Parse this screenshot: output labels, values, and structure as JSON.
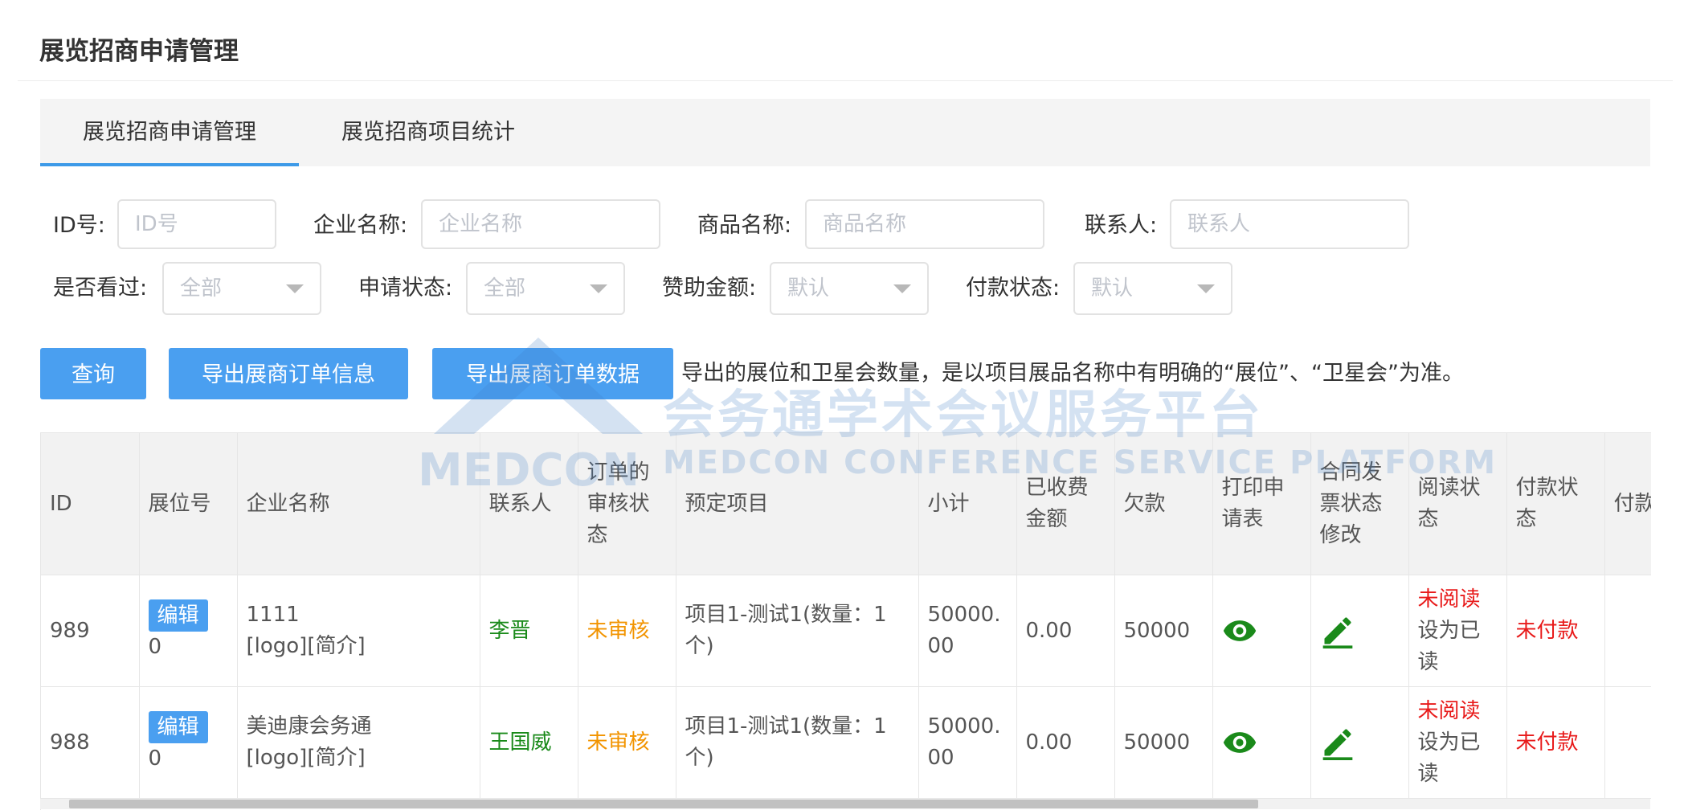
{
  "page_title": "展览招商申请管理",
  "tabs": [
    {
      "label": "展览招商申请管理",
      "active": true
    },
    {
      "label": "展览招商项目统计",
      "active": false
    }
  ],
  "filters": {
    "id": {
      "label": "ID号:",
      "placeholder": "ID号"
    },
    "company": {
      "label": "企业名称:",
      "placeholder": "企业名称"
    },
    "product": {
      "label": "商品名称:",
      "placeholder": "商品名称"
    },
    "contact": {
      "label": "联系人:",
      "placeholder": "联系人"
    },
    "viewed": {
      "label": "是否看过:",
      "value": "全部"
    },
    "apply_status": {
      "label": "申请状态:",
      "value": "全部"
    },
    "sponsor_amount": {
      "label": "赞助金额:",
      "value": "默认"
    },
    "pay_status": {
      "label": "付款状态:",
      "value": "默认"
    }
  },
  "buttons": {
    "query": "查询",
    "export_info": "导出展商订单信息",
    "export_data": "导出展商订单数据"
  },
  "export_note": "导出的展位和卫星会数量，是以项目展品名称中有明确的“展位”、“卫星会”为准。",
  "watermark": {
    "cn": "会务通学术会议服务平台",
    "en": "MEDCON CONFERENCE SERVICE PLATFORM",
    "logo": "MEDCON"
  },
  "table": {
    "headers": [
      "ID",
      "展位号",
      "企业名称",
      "联系人",
      "订单的审核状态",
      "预定项目",
      "小计",
      "已收费金额",
      "欠款",
      "打印申请表",
      "合同发票状态修改",
      "阅读状态",
      "付款状态",
      "付款时间"
    ],
    "rows": [
      {
        "id": "989",
        "edit_label": "编辑",
        "booth": "0",
        "company": "1111",
        "company_links": "[logo][简介]",
        "contact": "李晋",
        "audit": "未审核",
        "project": "项目1-测试1(数量：1个)",
        "subtotal": "50000.00",
        "paid": "0.00",
        "debt": "50000",
        "read_status": "未阅读",
        "set_read": "设为已读",
        "pay_status": "未付款",
        "pay_time": ""
      },
      {
        "id": "988",
        "edit_label": "编辑",
        "booth": "0",
        "company": "美迪康会务通",
        "company_links": "[logo][简介]",
        "contact": "王国威",
        "audit": "未审核",
        "project": "项目1-测试1(数量：1个)",
        "subtotal": "50000.00",
        "paid": "0.00",
        "debt": "50000",
        "read_status": "未阅读",
        "set_read": "设为已读",
        "pay_status": "未付款",
        "pay_time": ""
      }
    ]
  },
  "colors": {
    "accent": "#4a9ff0",
    "success": "#1a8a1a",
    "warning": "#f29400",
    "danger": "#e81b1b"
  },
  "icons": {
    "print": "eye-icon",
    "contract": "edit-pencil-icon"
  }
}
